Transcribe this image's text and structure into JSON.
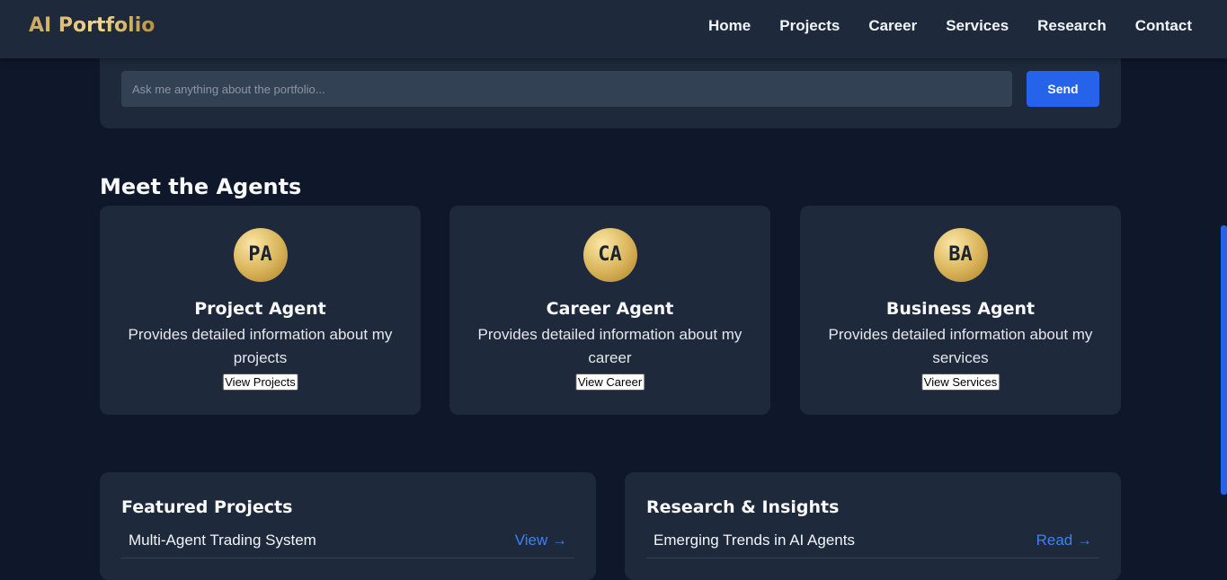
{
  "header": {
    "logo": "AI Portfolio",
    "nav": [
      "Home",
      "Projects",
      "Career",
      "Services",
      "Research",
      "Contact"
    ]
  },
  "chat": {
    "placeholder": "Ask me anything about the portfolio...",
    "send_label": "Send"
  },
  "agents_section": {
    "title": "Meet the Agents",
    "agents": [
      {
        "initials": "PA",
        "name": "Project Agent",
        "description": "Provides detailed information about my projects",
        "button": "View Projects"
      },
      {
        "initials": "CA",
        "name": "Career Agent",
        "description": "Provides detailed information about my career",
        "button": "View Career"
      },
      {
        "initials": "BA",
        "name": "Business Agent",
        "description": "Provides detailed information about my services",
        "button": "View Services"
      }
    ]
  },
  "featured_projects": {
    "title": "Featured Projects",
    "items": [
      {
        "title": "Multi-Agent Trading System",
        "link": "View →"
      }
    ]
  },
  "research": {
    "title": "Research & Insights",
    "items": [
      {
        "title": "Emerging Trends in AI Agents",
        "link": "Read →"
      }
    ]
  },
  "colors": {
    "background": "#0f172a",
    "card": "#1e293b",
    "accent": "#2563eb",
    "gold": "#d8b257"
  }
}
